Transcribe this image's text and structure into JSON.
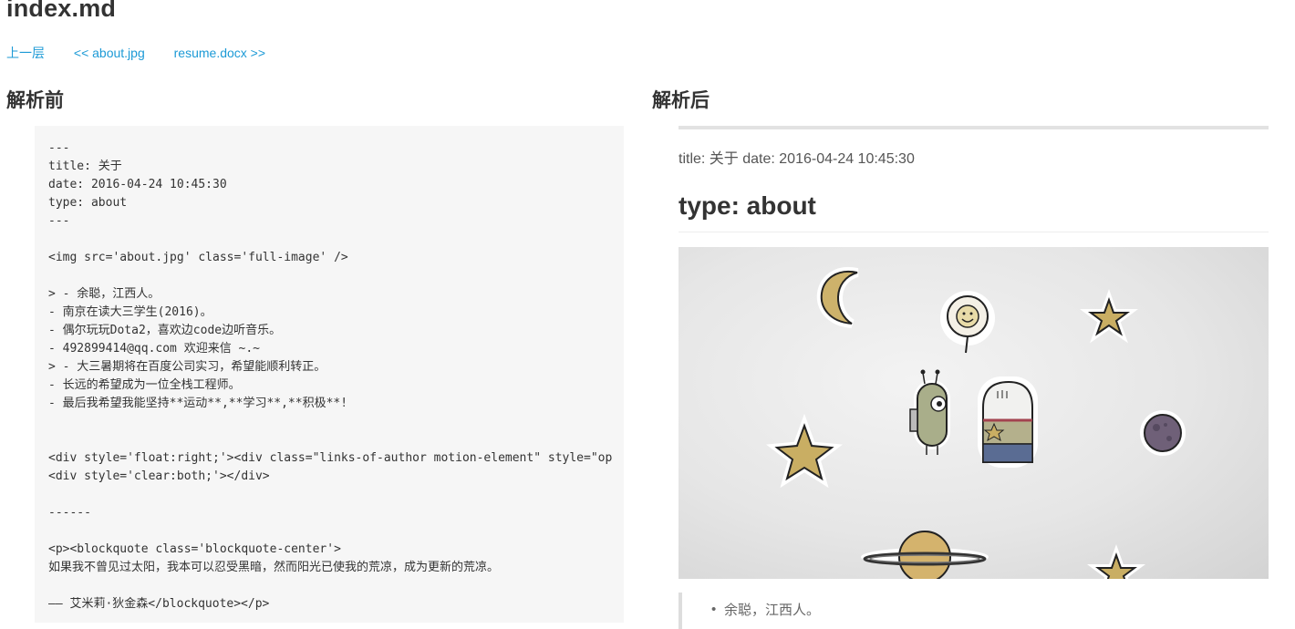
{
  "page": {
    "title": "index.md"
  },
  "nav": {
    "up": "上一层",
    "prev": "<< about.jpg",
    "next": "resume.docx >>"
  },
  "columns": {
    "before": "解析前",
    "after": "解析后"
  },
  "code": {
    "lines": [
      "---",
      "title: 关于",
      "date: 2016-04-24 10:45:30",
      "type: about",
      "---",
      "",
      "<img src='about.jpg' class='full-image' />",
      "",
      "> - 余聪，江西人。",
      "- 南京在读大三学生(2016)。",
      "- 偶尔玩玩Dota2，喜欢边code边听音乐。",
      "- 492899414@qq.com 欢迎来信 ~.~",
      "> - 大三暑期将在百度公司实习，希望能顺利转正。",
      "- 长远的希望成为一位全栈工程师。",
      "- 最后我希望我能坚持**运动**,**学习**,**积极**!",
      "",
      "",
      "<div style='float:right;'><div class=\"links-of-author motion-element\" style=\"op",
      "<div style='clear:both;'></div>",
      "",
      "------",
      "",
      "<p><blockquote class='blockquote-center'>",
      "如果我不曾见过太阳，我本可以忍受黑暗，然而阳光已使我的荒凉，成为更新的荒凉。",
      "",
      "—— 艾米莉·狄金森</blockquote></p>"
    ]
  },
  "preview": {
    "meta": "title: 关于 date: 2016-04-24 10:45:30",
    "heading": "type: about",
    "image_alt": "about.jpg",
    "list_item_1": "余聪，江西人。"
  },
  "colors": {
    "link": "#1c9ad6",
    "code_bg": "#f6f6f6"
  }
}
